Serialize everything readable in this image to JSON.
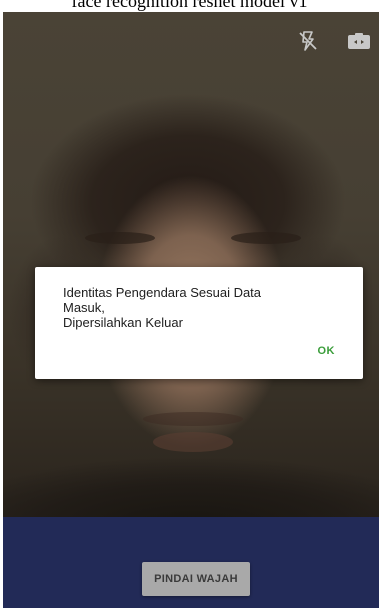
{
  "caption": "face recognition resnet model v1",
  "dialog": {
    "message_lines": [
      "Identitas Pengendara Sesuai Data",
      "Masuk,",
      "Dipersilahkan Keluar"
    ],
    "ok_label": "OK",
    "ok_color": "#3a9d3a"
  },
  "toolbar": {
    "flash_icon": "flash-off-icon",
    "camera_icon": "switch-camera-icon"
  },
  "bottom": {
    "scan_label": "PINDAI WAJAH",
    "bar_color": "#222a57"
  }
}
